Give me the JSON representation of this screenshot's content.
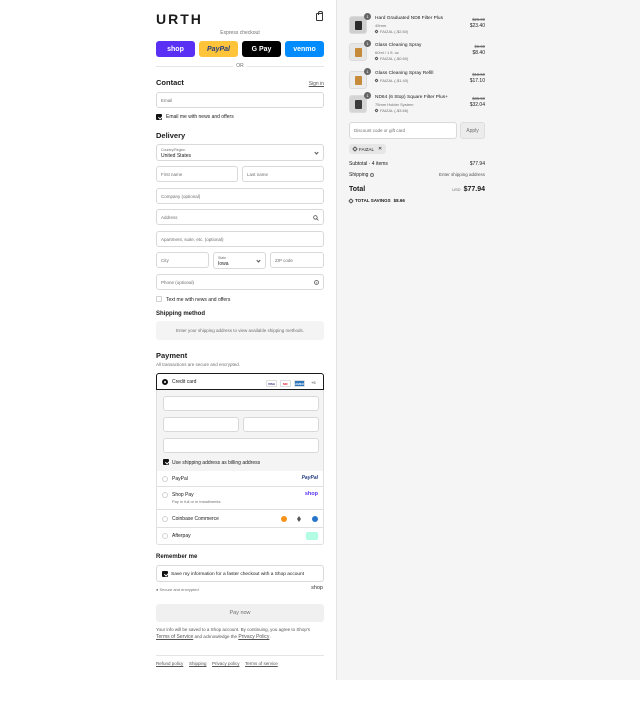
{
  "brand": {
    "logo": "URTH"
  },
  "express": {
    "title": "Express checkout",
    "buttons": [
      {
        "label": "shop",
        "bg": "#5a31f4",
        "fg": "#ffffff"
      },
      {
        "label": "PayPal",
        "bg": "#ffc439",
        "fg": "#253b80"
      },
      {
        "label": "G Pay",
        "bg": "#000000",
        "fg": "#ffffff"
      },
      {
        "label": "venmo",
        "bg": "#008cff",
        "fg": "#ffffff"
      }
    ],
    "or": "OR"
  },
  "contact": {
    "heading": "Contact",
    "sign_in": "Sign in",
    "email_placeholder": "Email",
    "news_label": "Email me with news and offers",
    "news_checked": true
  },
  "delivery": {
    "heading": "Delivery",
    "country_label": "Country/Region",
    "country_value": "United States",
    "first_name": "First name",
    "last_name": "Last name",
    "company": "Company (optional)",
    "address": "Address",
    "apartment": "Apartment, suite, etc. (optional)",
    "city": "City",
    "state_label": "State",
    "state_value": "Iowa",
    "zip": "ZIP code",
    "phone": "Phone (optional)",
    "text_label": "Text me with news and offers"
  },
  "shipping": {
    "heading": "Shipping method",
    "notice": "Enter your shipping address to view available shipping methods."
  },
  "payment": {
    "heading": "Payment",
    "subtitle": "All transactions are secure and encrypted.",
    "credit_card": "Credit card",
    "card_more": "+5",
    "card_logos": [
      {
        "label": "VISA",
        "bg": "#ffffff",
        "fg": "#1a1f71"
      },
      {
        "label": "MC",
        "bg": "#ffffff",
        "fg": "#eb001b"
      },
      {
        "label": "AMEX",
        "bg": "#2e77bc",
        "fg": "#ffffff"
      }
    ],
    "billing_label": "Use shipping address as billing address",
    "methods": [
      {
        "label": "PayPal",
        "sub": "",
        "logo": "PayPal"
      },
      {
        "label": "Shop Pay",
        "sub": "Pay in full or in installments",
        "logo": "shop"
      },
      {
        "label": "Coinbase Commerce",
        "sub": "",
        "logo": ""
      },
      {
        "label": "Afterpay",
        "sub": "",
        "logo": ""
      }
    ]
  },
  "remember": {
    "heading": "Remember me",
    "save_label": "Save my information for a faster checkout with a Shop account",
    "secure": "Secure and encrypted",
    "shop_logo": "shop"
  },
  "pay_now": "Pay now",
  "disclaimer": {
    "text": "Your info will be saved to a Shop account. By continuing, you agree to Shop's",
    "terms": "Terms of Service",
    "and": "and acknowledge the",
    "privacy": "Privacy Policy",
    "end": "."
  },
  "footer": [
    "Refund policy",
    "Shipping",
    "Privacy policy",
    "Terms of service"
  ],
  "order": {
    "items": [
      {
        "qty": "1",
        "name": "Hard Graduated ND8 Filter Plus",
        "variant": "49mm",
        "discount": "FAIZAL (-$2.60)",
        "was": "$25.00",
        "price": "$23.40"
      },
      {
        "qty": "1",
        "name": "Glass Cleaning Spray",
        "variant": "60ml / 1 fl. oz",
        "discount": "FAIZAL (-$0.60)",
        "was": "$9.00",
        "price": "$8.40"
      },
      {
        "qty": "1",
        "name": "Glass Cleaning Spray Refill",
        "variant": "",
        "discount": "FAIZAL (-$1.40)",
        "was": "$18.50",
        "price": "$17.10"
      },
      {
        "qty": "1",
        "name": "ND64 (6 Stop) Square Filter Plus+",
        "variant": "75mm Holder System",
        "discount": "FAIZAL (-$3.66)",
        "was": "$35.50",
        "price": "$32.04"
      }
    ],
    "discount_placeholder": "Discount code or gift card",
    "apply": "Apply",
    "code_tag": "FAIZAL",
    "subtotal_label": "Subtotal · 4 items",
    "subtotal": "$77.94",
    "shipping_label": "Shipping",
    "shipping_value": "Enter shipping address",
    "total_label": "Total",
    "currency": "USD",
    "total": "$77.94",
    "savings_label": "TOTAL SAVINGS",
    "savings": "$8.66"
  }
}
